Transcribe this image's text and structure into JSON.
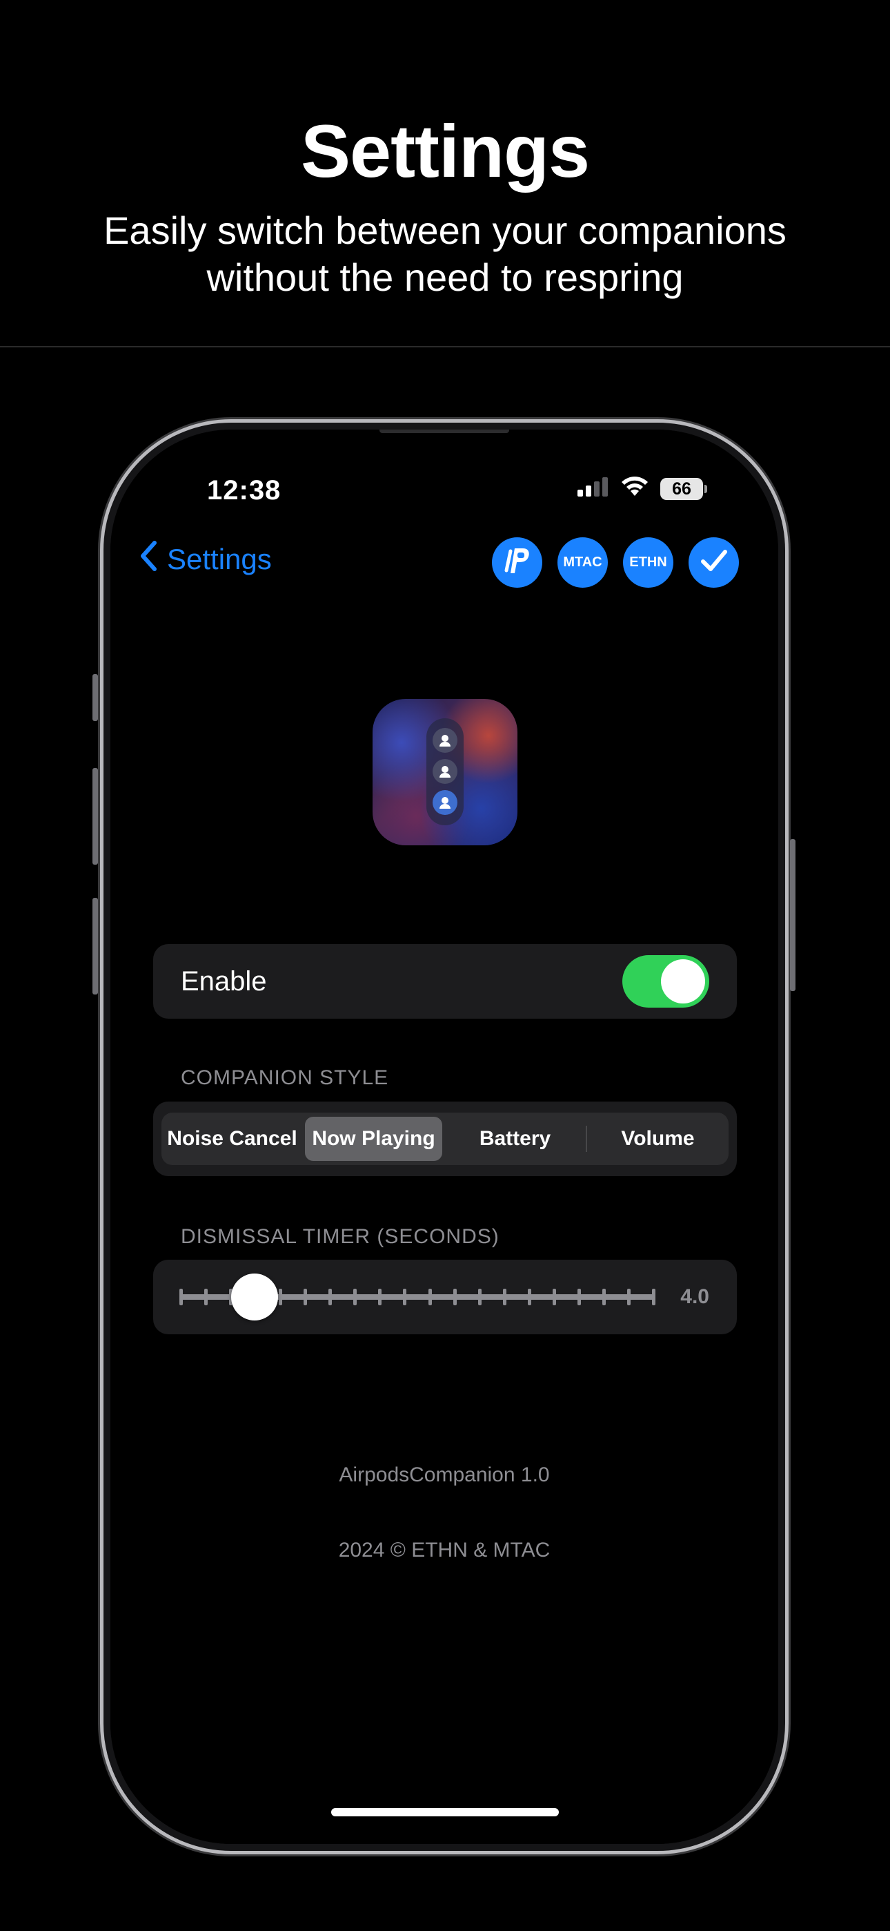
{
  "hero": {
    "title": "Settings",
    "subtitle": "Easily switch between your companions\nwithout the need to respring"
  },
  "status_bar": {
    "time": "12:38",
    "battery": "66"
  },
  "nav": {
    "back_label": "Settings",
    "icons": [
      {
        "name": "paypal-icon",
        "label": ""
      },
      {
        "name": "mtac-icon",
        "label": "MTAC"
      },
      {
        "name": "ethn-icon",
        "label": "ETHN"
      },
      {
        "name": "checkmark-icon",
        "label": ""
      }
    ]
  },
  "enable": {
    "label": "Enable",
    "on": true
  },
  "companion_style": {
    "header": "COMPANION STYLE",
    "options": [
      "Noise Cancel",
      "Now Playing",
      "Battery",
      "Volume"
    ],
    "selected": "Now Playing"
  },
  "dismissal_timer": {
    "header": "DISMISSAL TIMER (SECONDS)",
    "value": "4.0",
    "min": 1.0,
    "max": 20.0
  },
  "footer": {
    "version": "AirpodsCompanion 1.0",
    "copyright": "2024 © ETHN & MTAC"
  },
  "colors": {
    "accent": "#1a82ff",
    "toggle_on": "#30d158",
    "card": "#1c1c1e",
    "secondary_text": "#8e8e93"
  }
}
